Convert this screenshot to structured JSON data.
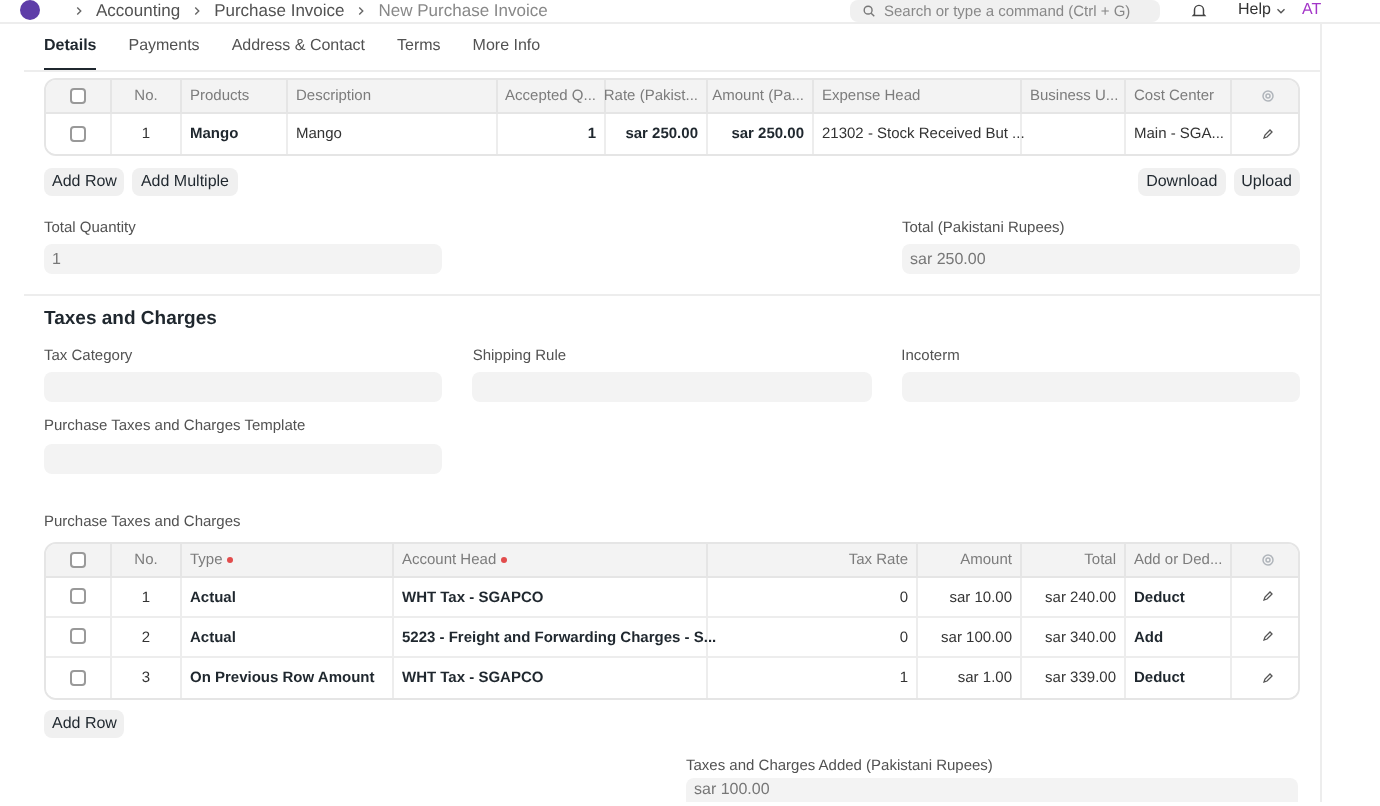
{
  "navbar": {
    "breadcrumbs": [
      "Accounting",
      "Purchase Invoice",
      "New Purchase Invoice"
    ],
    "search": {
      "placeholder": "Search or type a command (Ctrl + G)"
    },
    "help": "Help",
    "avatar": "AT"
  },
  "tabs": [
    {
      "label": "Details",
      "selected": true
    },
    {
      "label": "Payments",
      "selected": false
    },
    {
      "label": "Address & Contact",
      "selected": false
    },
    {
      "label": "Terms",
      "selected": false
    },
    {
      "label": "More Info",
      "selected": false
    }
  ],
  "items_table": {
    "header_checked": false,
    "columns": [
      {
        "label": "No.",
        "required": false
      },
      {
        "label": "Products",
        "required": false
      },
      {
        "label": "Description",
        "required": false
      },
      {
        "label": "Accepted Q...",
        "required": false
      },
      {
        "label": "Rate (Pakist...",
        "required": false
      },
      {
        "label": "Amount (Pa...",
        "required": false
      },
      {
        "label": "Expense Head",
        "required": false
      },
      {
        "label": "Business U...",
        "required": false
      },
      {
        "label": "Cost Center",
        "required": false
      }
    ],
    "rows": [
      {
        "checked": false,
        "cells": [
          "1",
          "Mango",
          "Mango",
          "1",
          "sar 250.00",
          "sar 250.00",
          "21302 - Stock Received But ...",
          "",
          "Main - SGA..."
        ]
      }
    ],
    "buttons": [
      "Add Row",
      "Add Multiple"
    ],
    "right_buttons": [
      "Download",
      "Upload"
    ]
  },
  "totals": [
    {
      "label": "Total Quantity",
      "value": "1"
    },
    {
      "label": "Total (Pakistani Rupees)",
      "value": "sar 250.00"
    }
  ],
  "taxes_section": {
    "title": "Taxes and Charges",
    "fields": [
      {
        "label": "Tax Category"
      },
      {
        "label": "Shipping Rule"
      },
      {
        "label": "Incoterm"
      },
      {
        "label": "Purchase Taxes and Charges Template"
      }
    ]
  },
  "taxes_table": {
    "title": "Purchase Taxes and Charges",
    "header_checked": false,
    "columns": [
      {
        "label": "No.",
        "required": false
      },
      {
        "label": "Type",
        "required": true
      },
      {
        "label": "Account Head",
        "required": true
      },
      {
        "label": "Tax Rate",
        "required": false
      },
      {
        "label": "Amount",
        "required": false
      },
      {
        "label": "Total",
        "required": false
      },
      {
        "label": "Add or Ded...",
        "required": false
      }
    ],
    "rows": [
      {
        "checked": false,
        "cells": [
          "1",
          "Actual",
          "WHT Tax - SGAPCO",
          "0",
          "sar 10.00",
          "sar 240.00",
          "Deduct"
        ]
      },
      {
        "checked": false,
        "cells": [
          "2",
          "Actual",
          "5223 - Freight and Forwarding Charges - S...",
          "0",
          "sar 100.00",
          "sar 340.00",
          "Add"
        ]
      },
      {
        "checked": false,
        "cells": [
          "3",
          "On Previous Row Amount",
          "WHT Tax - SGAPCO",
          "1",
          "sar 1.00",
          "sar 339.00",
          "Deduct"
        ]
      }
    ],
    "buttons": [
      "Add Row"
    ]
  },
  "taxes_added": {
    "label": "Taxes and Charges Added (Pakistani Rupees)",
    "value": "sar 100.00"
  }
}
